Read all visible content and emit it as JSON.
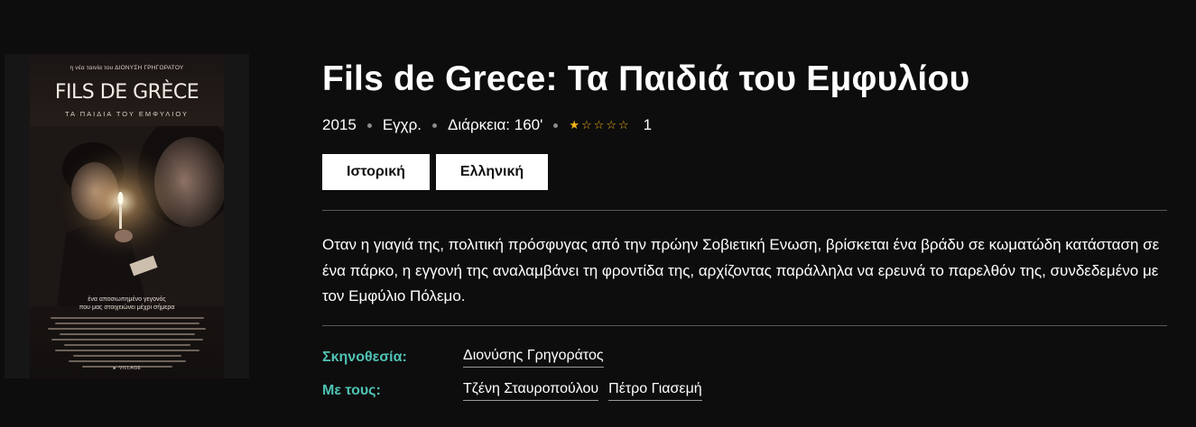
{
  "poster": {
    "tagline": "η νέα ταινία του ΔΙΟΝΥΣΗ ΓΡΗΓΟΡΑΤΟΥ",
    "title": "FILS DE GRÈCE",
    "subtitle": "ΤΑ ΠΑΙΔΙΑ ΤΟΥ ΕΜΦΥΛΙΟΥ",
    "caption_line1": "ένα αποσιωπημένο γεγονός",
    "caption_line2": "που μας στοιχειώνει μέχρι σήμερα",
    "distributor": "► VILLAGE"
  },
  "movie": {
    "title": "Fils de Grece: Τα Παιδιά του Εμφυλίου",
    "year": "2015",
    "color": "Εγχρ.",
    "duration": "Διάρκεια: 160'",
    "rating": {
      "stars_filled": 1,
      "stars_total": 5,
      "count": "1"
    },
    "genres": [
      "Ιστορική",
      "Ελληνική"
    ],
    "synopsis": "Οταν η γιαγιά της, πολιτική πρόσφυγας από την πρώην Σοβιετική Ενωση, βρίσκεται ένα βράδυ σε κωματώδη κατάσταση σε ένα πάρκο, η εγγονή της αναλαμβάνει τη φροντίδα της, αρχίζοντας παράλληλα να ερευνά το παρελθόν της, συνδεδεμένο με τον Εμφύλιο Πόλεμο."
  },
  "credits": {
    "director_label": "Σκηνοθεσία:",
    "directors": [
      "Διονύσης Γρηγοράτος"
    ],
    "cast_label": "Με τους:",
    "cast": [
      "Τζένη Σταυροπούλου",
      "Πέτρο Γιασεμή"
    ]
  },
  "colors": {
    "background": "#0e0d0d",
    "accent": "#4fc3b4",
    "star": "#f3b51b"
  }
}
